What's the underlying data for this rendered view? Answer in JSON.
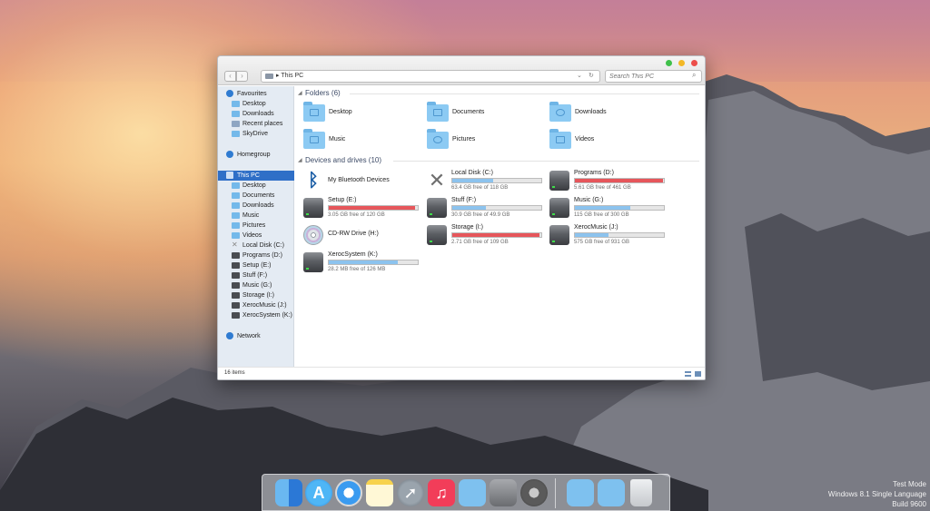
{
  "window": {
    "address": "This PC",
    "search_placeholder": "Search This PC",
    "status_count": "16 items"
  },
  "sidebar": {
    "favourites": "Favourites",
    "favourite_items": [
      "Desktop",
      "Downloads",
      "Recent places",
      "SkyDrive"
    ],
    "homegroup": "Homegroup",
    "this_pc": "This PC",
    "pc_items": [
      "Desktop",
      "Documents",
      "Downloads",
      "Music",
      "Pictures",
      "Videos",
      "Local Disk (C:)",
      "Programs (D:)",
      "Setup (E:)",
      "Stuff (F:)",
      "Music (G:)",
      "Storage (I:)",
      "XerocMusic (J:)",
      "XerocSystem (K:)"
    ],
    "network": "Network"
  },
  "folders": {
    "title": "Folders (6)",
    "items": [
      "Desktop",
      "Documents",
      "Downloads",
      "Music",
      "Pictures",
      "Videos"
    ]
  },
  "devices": {
    "title": "Devices and drives (10)",
    "items": [
      {
        "name": "My Bluetooth Devices",
        "icon": "bluetooth-icon"
      },
      {
        "name": "Local Disk (C:)",
        "free": "63.4 GB free of 118 GB",
        "used_pct": 46
      },
      {
        "name": "Programs (D:)",
        "free": "5.61 GB free of 461 GB",
        "used_pct": 99
      },
      {
        "name": "Setup (E:)",
        "free": "3.05 GB free of 120 GB",
        "used_pct": 97
      },
      {
        "name": "Stuff (F:)",
        "free": "30.9 GB free of 49.9 GB",
        "used_pct": 38
      },
      {
        "name": "Music (G:)",
        "free": "115 GB free of 300 GB",
        "used_pct": 62
      },
      {
        "name": "CD-RW Drive (H:)",
        "icon": "cd-icon"
      },
      {
        "name": "Storage (I:)",
        "free": "2.71 GB free of 109 GB",
        "used_pct": 98
      },
      {
        "name": "XerocMusic (J:)",
        "free": "575 GB free of 931 GB",
        "used_pct": 38
      },
      {
        "name": "XerocSystem (K:)",
        "free": "28.2 MB free of 126 MB",
        "used_pct": 78
      }
    ]
  },
  "watermark": {
    "line1": "Test Mode",
    "line2": "Windows 8.1 Single Language",
    "line3": "Build 9600"
  },
  "colors": {
    "accent": "#2f6fc7",
    "folder": "#8ccaf3",
    "bar_normal": "#8cc3ee",
    "bar_full": "#e6565b"
  }
}
